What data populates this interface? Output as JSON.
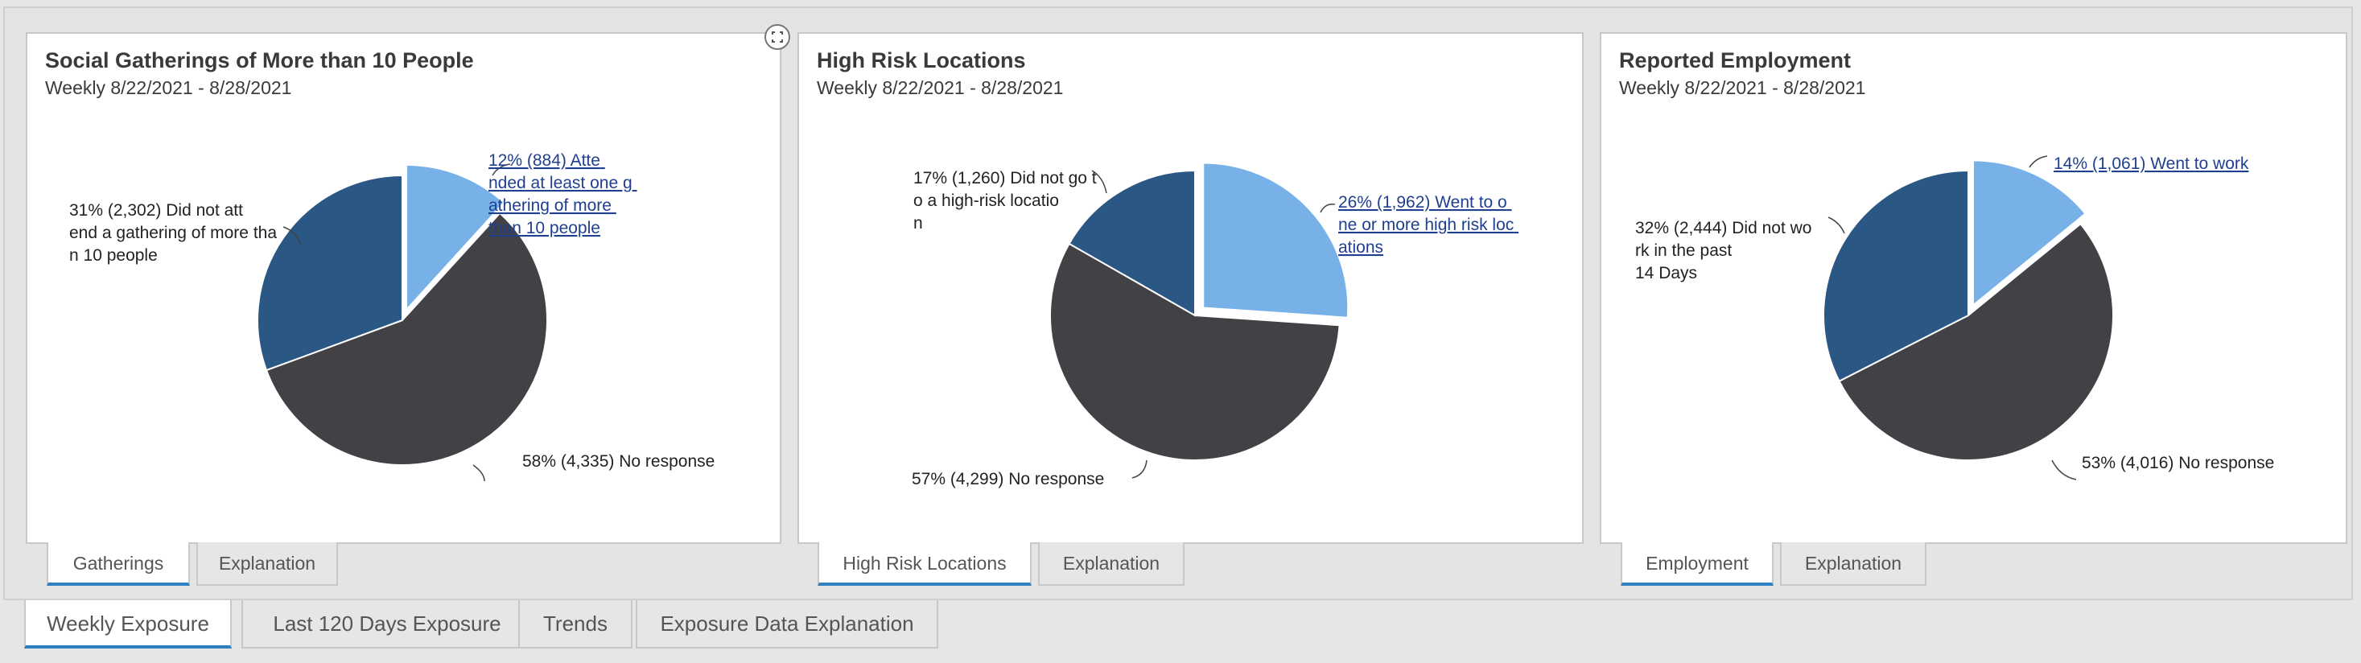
{
  "colors": {
    "dark": "#414146",
    "navy": "#2b5784",
    "light": "#78b1e8",
    "link": "#1f3f8f",
    "accent": "#2f7fc1"
  },
  "icons": {
    "expand": "expand-icon"
  },
  "chart_data": [
    {
      "type": "pie",
      "title": "Social Gatherings of More than 10 People",
      "subtitle": "Weekly 8/22/2021 - 8/28/2021",
      "slices": [
        {
          "label": "12% (884) Attended at least one gathering of more than 10 people",
          "percent": 12,
          "count": 884,
          "color": "#78b1e8",
          "exploded": true
        },
        {
          "label": "58% (4,335) No response",
          "percent": 58,
          "count": 4335,
          "color": "#414146",
          "exploded": false
        },
        {
          "label": "31% (2,302) Did not attend a gathering of more than 10 people",
          "percent": 31,
          "count": 2302,
          "color": "#2b5784",
          "exploded": false
        }
      ]
    },
    {
      "type": "pie",
      "title": "High Risk Locations",
      "subtitle": "Weekly 8/22/2021 - 8/28/2021",
      "slices": [
        {
          "label": "26% (1,962) Went to one or more high risk locations",
          "percent": 26,
          "count": 1962,
          "color": "#78b1e8",
          "exploded": true
        },
        {
          "label": "57% (4,299) No response",
          "percent": 57,
          "count": 4299,
          "color": "#414146",
          "exploded": false
        },
        {
          "label": "17% (1,260) Did not go to a high-risk location",
          "percent": 17,
          "count": 1260,
          "color": "#2b5784",
          "exploded": false
        }
      ]
    },
    {
      "type": "pie",
      "title": "Reported Employment",
      "subtitle": "Weekly 8/22/2021 - 8/28/2021",
      "slices": [
        {
          "label": "14% (1,061) Went to work",
          "percent": 14,
          "count": 1061,
          "color": "#78b1e8",
          "exploded": true
        },
        {
          "label": "53% (4,016) No response",
          "percent": 53,
          "count": 4016,
          "color": "#414146",
          "exploded": false
        },
        {
          "label": "32% (2,444) Did not work in the past 14 Days",
          "percent": 32,
          "count": 2444,
          "color": "#2b5784",
          "exploded": false
        }
      ]
    }
  ],
  "panel_tabs": [
    [
      "Gatherings",
      "Explanation"
    ],
    [
      "High Risk Locations",
      "Explanation"
    ],
    [
      "Employment",
      "Explanation"
    ]
  ],
  "bottom_tabs": [
    "Weekly Exposure",
    "Last 120 Days Exposure",
    "Trends",
    "Exposure Data Explanation"
  ]
}
